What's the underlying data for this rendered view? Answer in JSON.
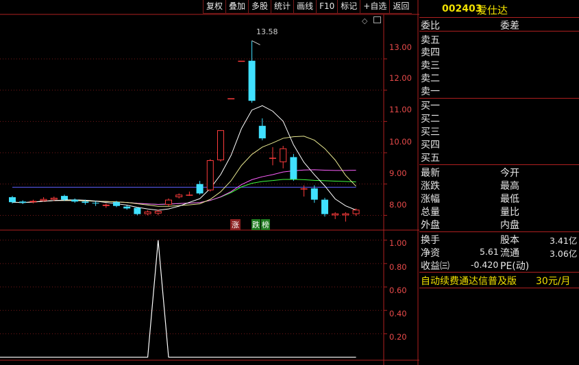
{
  "toolbar": {
    "items": [
      "复权",
      "叠加",
      "多股",
      "统计",
      "画线",
      "F10",
      "标记",
      "+自选",
      "返回"
    ]
  },
  "stock": {
    "code": "002403",
    "name": "爱仕达"
  },
  "order_book": {
    "wei_bi": "委比",
    "wei_cha": "委差",
    "sell": [
      "卖五",
      "卖四",
      "卖三",
      "卖二",
      "卖一"
    ],
    "buy": [
      "买一",
      "买二",
      "买三",
      "买四",
      "买五"
    ]
  },
  "quote": {
    "left": [
      "最新",
      "涨跌",
      "涨幅",
      "总量",
      "外盘"
    ],
    "right": [
      "今开",
      "最高",
      "最低",
      "量比",
      "内盘"
    ]
  },
  "fundamentals": {
    "turnover_label": "换手",
    "share_capital_label": "股本",
    "share_capital_value": "3.41亿",
    "net_asset_label": "净资",
    "net_asset_value": "5.61",
    "float_label": "流通",
    "float_value": "3.06亿",
    "eps_label": "收益㈢",
    "eps_value": "-0.420",
    "pe_label": "PE(动)"
  },
  "promo": {
    "text": "自动续费通达信普及版",
    "price": "30元/月"
  },
  "markers": {
    "zhang": "涨",
    "die": "跌",
    "bang": "榜"
  },
  "colors": {
    "up": "#ff3c3c",
    "down": "#40e0ff",
    "grid": "#7a1a1a",
    "border": "#b02020",
    "ma5": "#ffffff",
    "ma10": "#e8e890",
    "ma20": "#ff60ff",
    "ma30": "#40ff40",
    "ma60": "#6060ff"
  },
  "chart_data": [
    {
      "type": "candlestick",
      "y_ticks": [
        13.0,
        12.0,
        11.0,
        10.0,
        9.0,
        8.0
      ],
      "ylim": [
        7.55,
        14.4
      ],
      "annotation": "13.58",
      "high_value": 13.58,
      "candles": [
        {
          "o": 8.58,
          "c": 8.42,
          "h": 8.62,
          "l": 8.38
        },
        {
          "o": 8.44,
          "c": 8.4,
          "h": 8.48,
          "l": 8.36
        },
        {
          "o": 8.42,
          "c": 8.46,
          "h": 8.5,
          "l": 8.38
        },
        {
          "o": 8.46,
          "c": 8.52,
          "h": 8.58,
          "l": 8.44
        },
        {
          "o": 8.5,
          "c": 8.56,
          "h": 8.6,
          "l": 8.46
        },
        {
          "o": 8.62,
          "c": 8.5,
          "h": 8.66,
          "l": 8.46
        },
        {
          "o": 8.5,
          "c": 8.44,
          "h": 8.54,
          "l": 8.4
        },
        {
          "o": 8.44,
          "c": 8.4,
          "h": 8.5,
          "l": 8.34
        },
        {
          "o": 8.4,
          "c": 8.38,
          "h": 8.46,
          "l": 8.3
        },
        {
          "o": 8.3,
          "c": 8.34,
          "h": 8.38,
          "l": 8.24
        },
        {
          "o": 8.42,
          "c": 8.3,
          "h": 8.46,
          "l": 8.26
        },
        {
          "o": 8.28,
          "c": 8.22,
          "h": 8.32,
          "l": 8.18
        },
        {
          "o": 8.24,
          "c": 8.04,
          "h": 8.26,
          "l": 8.0
        },
        {
          "o": 8.04,
          "c": 8.12,
          "h": 8.16,
          "l": 8.0
        },
        {
          "o": 8.06,
          "c": 8.14,
          "h": 8.18,
          "l": 8.0
        },
        {
          "o": 8.34,
          "c": 8.5,
          "h": 8.54,
          "l": 8.3
        },
        {
          "o": 8.58,
          "c": 8.66,
          "h": 8.7,
          "l": 8.54
        },
        {
          "o": 8.66,
          "c": 8.66,
          "h": 8.76,
          "l": 8.62
        },
        {
          "o": 9.0,
          "c": 8.7,
          "h": 9.1,
          "l": 8.66
        },
        {
          "o": 8.8,
          "c": 9.76,
          "h": 9.8,
          "l": 8.76
        },
        {
          "o": 9.76,
          "c": 10.72,
          "h": 10.72,
          "l": 9.72
        },
        {
          "o": 11.74,
          "c": 11.74,
          "h": 11.74,
          "l": 11.74
        },
        {
          "o": 12.94,
          "c": 12.94,
          "h": 12.94,
          "l": 12.94
        },
        {
          "o": 12.94,
          "c": 11.66,
          "h": 13.58,
          "l": 11.6
        },
        {
          "o": 10.86,
          "c": 10.46,
          "h": 11.1,
          "l": 10.4
        },
        {
          "o": 9.84,
          "c": 9.84,
          "h": 10.18,
          "l": 9.6
        },
        {
          "o": 9.7,
          "c": 10.14,
          "h": 10.22,
          "l": 9.5
        },
        {
          "o": 9.86,
          "c": 9.16,
          "h": 9.96,
          "l": 9.1
        },
        {
          "o": 8.86,
          "c": 8.86,
          "h": 8.96,
          "l": 8.6
        },
        {
          "o": 8.86,
          "c": 8.5,
          "h": 8.96,
          "l": 8.4
        },
        {
          "o": 8.5,
          "c": 8.04,
          "h": 8.56,
          "l": 7.96
        },
        {
          "o": 8.0,
          "c": 8.06,
          "h": 8.1,
          "l": 7.88
        },
        {
          "o": 8.0,
          "c": 8.06,
          "h": 8.1,
          "l": 7.8
        },
        {
          "o": 8.04,
          "c": 8.18,
          "h": 8.22,
          "l": 7.98
        }
      ]
    },
    {
      "type": "line",
      "y_ticks": [
        1.0,
        0.8,
        0.6,
        0.4,
        0.2
      ],
      "ylim": [
        -0.02,
        1.08
      ],
      "values": [
        0,
        0,
        0,
        0,
        0,
        0,
        0,
        0,
        0,
        0,
        0,
        0,
        0,
        0,
        1,
        0,
        0,
        0,
        0,
        0,
        0,
        0,
        0,
        0,
        0,
        0,
        0,
        0,
        0,
        0,
        0,
        0,
        0,
        0
      ]
    }
  ]
}
